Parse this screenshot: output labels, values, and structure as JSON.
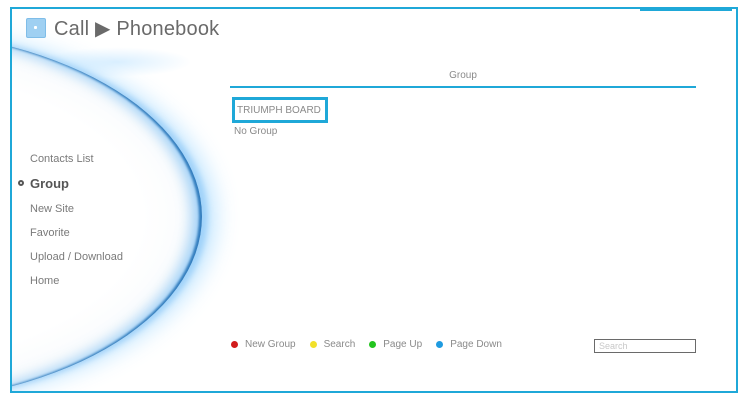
{
  "header": {
    "title": "Call ▶ Phonebook",
    "icon": "app-icon"
  },
  "nav": {
    "items": [
      {
        "label": "Contacts List",
        "active": false
      },
      {
        "label": "Group",
        "active": true
      },
      {
        "label": "New Site",
        "active": false
      },
      {
        "label": "Favorite",
        "active": false
      },
      {
        "label": "Upload / Download",
        "active": false
      },
      {
        "label": "Home",
        "active": false
      }
    ]
  },
  "content": {
    "column_header": "Group",
    "groups": [
      "TRIUMPH BOARD",
      "No Group"
    ],
    "selected_group": "TRIUMPH BOARD"
  },
  "footer": {
    "legend": [
      {
        "label": "New Group",
        "color": "#d11b1b"
      },
      {
        "label": "Search",
        "color": "#f2e02a"
      },
      {
        "label": "Page Up",
        "color": "#22c41e"
      },
      {
        "label": "Page Down",
        "color": "#1f9be0"
      }
    ],
    "search_placeholder": "Search"
  },
  "colors": {
    "accent": "#1fa8d8"
  }
}
